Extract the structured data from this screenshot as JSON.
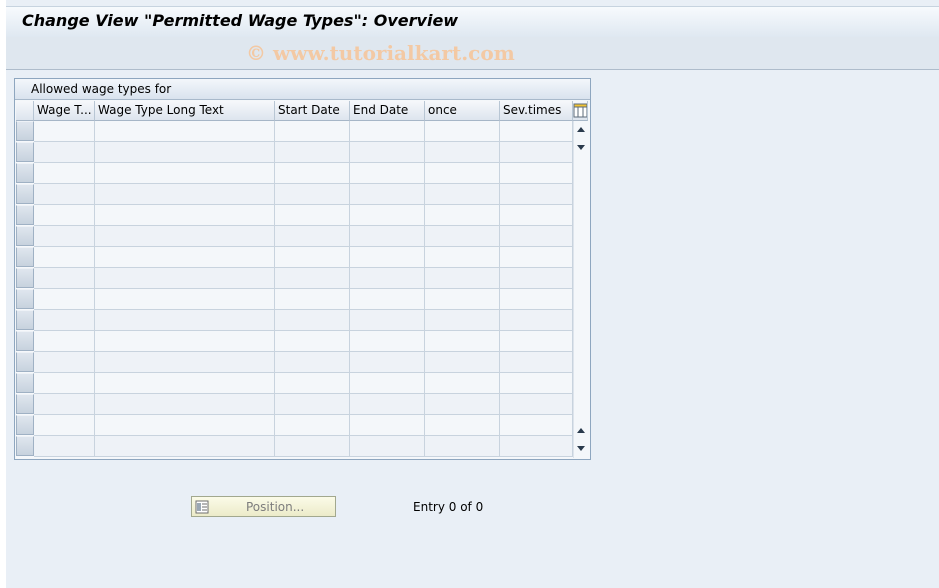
{
  "window": {
    "title": "Change View \"Permitted Wage Types\": Overview",
    "watermark": "© www.tutorialkart.com"
  },
  "table": {
    "title": "Allowed wage types for",
    "columns": [
      "Wage T...",
      "Wage Type Long Text",
      "Start Date",
      "End Date",
      "once",
      "Sev.times"
    ],
    "row_count": 16,
    "rows": []
  },
  "footer": {
    "position_button_label": "Position...",
    "entry_text": "Entry 0 of 0"
  },
  "icons": {
    "column_settings": "column-settings-icon",
    "scroll_up": "scroll-up-icon",
    "scroll_down": "scroll-down-icon",
    "position": "position-icon"
  },
  "colors": {
    "background": "#e9eff6",
    "panel_border": "#8ea6bf",
    "button_face": "#fbfbe8"
  }
}
